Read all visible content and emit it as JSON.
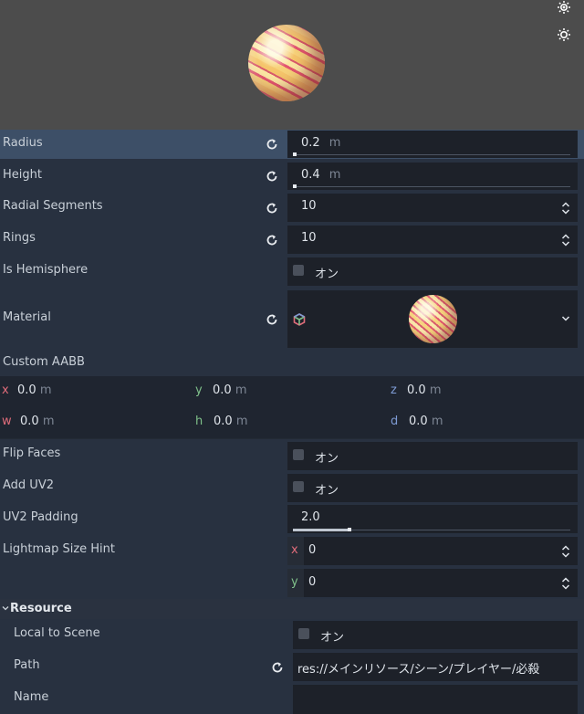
{
  "preview": {
    "light1_icon": "light-icon",
    "light2_icon": "light-icon"
  },
  "props": {
    "radius": {
      "label": "Radius",
      "value": "0.2",
      "unit": "m"
    },
    "height": {
      "label": "Height",
      "value": "0.4",
      "unit": "m"
    },
    "radial_segments": {
      "label": "Radial Segments",
      "value": "10"
    },
    "rings": {
      "label": "Rings",
      "value": "10"
    },
    "is_hemisphere": {
      "label": "Is Hemisphere",
      "check_label": "オン"
    },
    "material": {
      "label": "Material"
    },
    "custom_aabb": {
      "label": "Custom AABB",
      "x": {
        "axis": "x",
        "value": "0.0",
        "unit": "m"
      },
      "y": {
        "axis": "y",
        "value": "0.0",
        "unit": "m"
      },
      "z": {
        "axis": "z",
        "value": "0.0",
        "unit": "m"
      },
      "w": {
        "axis": "w",
        "value": "0.0",
        "unit": "m"
      },
      "h": {
        "axis": "h",
        "value": "0.0",
        "unit": "m"
      },
      "d": {
        "axis": "d",
        "value": "0.0",
        "unit": "m"
      }
    },
    "flip_faces": {
      "label": "Flip Faces",
      "check_label": "オン"
    },
    "add_uv2": {
      "label": "Add UV2",
      "check_label": "オン"
    },
    "uv2_padding": {
      "label": "UV2 Padding",
      "value": "2.0"
    },
    "lightmap_size_hint": {
      "label": "Lightmap Size Hint",
      "x": {
        "axis": "x",
        "value": "0"
      },
      "y": {
        "axis": "y",
        "value": "0"
      }
    }
  },
  "resource": {
    "title": "Resource",
    "local_to_scene": {
      "label": "Local to Scene",
      "check_label": "オン"
    },
    "path": {
      "label": "Path",
      "value": "res://メインリソース/シーン/プレイヤー/必殺"
    },
    "name": {
      "label": "Name",
      "value": ""
    }
  },
  "colors": {
    "accent_red": "#e06c7a",
    "accent_green": "#7fc08a",
    "accent_blue": "#7e9bd4",
    "selected_row": "#3d4f67"
  }
}
